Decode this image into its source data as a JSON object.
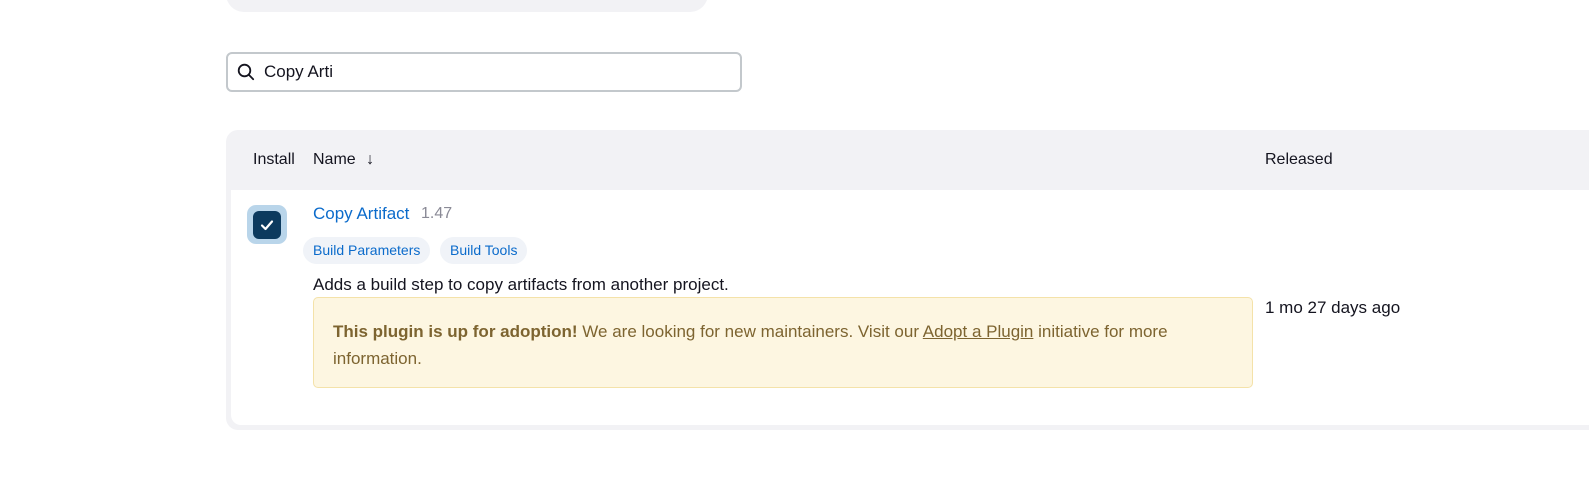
{
  "search": {
    "value": "Copy Arti"
  },
  "table": {
    "headers": {
      "install": "Install",
      "name": "Name",
      "sort_indicator": "↓",
      "released": "Released"
    },
    "rows": [
      {
        "installed_checked": true,
        "name": "Copy Artifact",
        "version": "1.47",
        "tags": [
          "Build Parameters",
          "Build Tools"
        ],
        "description": "Adds a build step to copy artifacts from another project.",
        "adoption_notice": {
          "bold": "This plugin is up for adoption!",
          "text_before_link": " We are looking for new maintainers. Visit our ",
          "link_text": "Adopt a Plugin",
          "text_after_link": " initiative for more information."
        },
        "released": "1 mo 27 days ago"
      }
    ]
  },
  "colors": {
    "link": "#0b6bcb",
    "checkbox": "#0c3a5e",
    "notice_bg": "#fdf6e1",
    "notice_text": "#7d6430"
  },
  "icons": {
    "search": "search-icon",
    "check": "check-icon",
    "sort": "arrow-down-icon"
  }
}
